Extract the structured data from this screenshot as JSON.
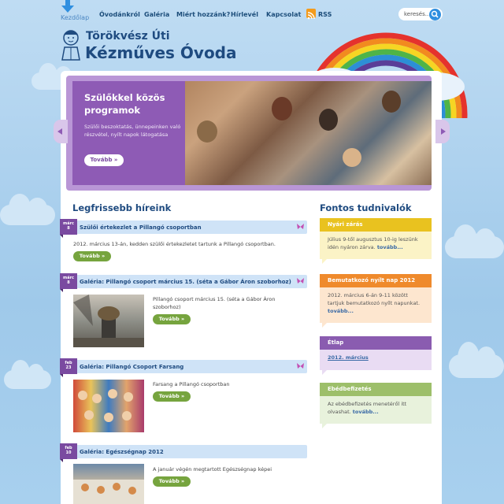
{
  "nav": {
    "items": [
      "Kezdőlap",
      "Óvodánkról",
      "Galéria",
      "Miért hozzánk?",
      "Hírlevél",
      "Kapcsolat",
      "RSS"
    ],
    "search_placeholder": "keresés..."
  },
  "logo": {
    "line1": "Törökvész Úti",
    "line2": "Kézműves Óvoda"
  },
  "slider": {
    "title": "Szülőkkel közös programok",
    "description": "Szülői beszoktatás, ünnepeinken való részvétel, nyílt napok látogatása",
    "button": "Tovább »"
  },
  "news": {
    "heading": "Legfrissebb híreink",
    "items": [
      {
        "month": "márc",
        "day": "8",
        "title": "Szülői értekezlet a Pillangó csoportban",
        "text": "2012. március 13-án, kedden szülői értekezletet tartunk a Pillangó csoportban.",
        "button": "Tovább »"
      },
      {
        "month": "márc",
        "day": "8",
        "title": "Galéria: Pillangó csoport március 15. (séta a Gábor Áron szoborhoz)",
        "text": "Pillangó csoport március 15. (séta a Gábor Áron szoborhoz)",
        "button": "Tovább »"
      },
      {
        "month": "feb",
        "day": "23",
        "title": "Galéria: Pillangó Csoport Farsang",
        "text": "Farsang a Pillangó csoportban",
        "button": "Tovább »"
      },
      {
        "month": "feb",
        "day": "10",
        "title": "Galéria: Egészségnap 2012",
        "text": "A január végén megtartott Egészségnap képei",
        "button": "Tovább »"
      }
    ]
  },
  "notices": {
    "heading": "Fontos tudnivalók",
    "boxes": [
      {
        "title": "Nyári zárás",
        "text": "Július 9-től augusztus 10-ig leszünk idén nyáron zárva.",
        "link": "tovább...",
        "head_color": "#e9c21f",
        "body_color": "#fbf3c6"
      },
      {
        "title": "Bemutatkozó nyílt nap 2012",
        "text": "2012. március 6-án 9-11 között tartjuk bemutatkozó nyílt napunkat.",
        "link": "tovább...",
        "head_color": "#ef8a2c",
        "body_color": "#fde6cf"
      },
      {
        "title": "Étlap",
        "text": "",
        "link": "2012. március",
        "head_color": "#8a5cb0",
        "body_color": "#e9dcf3"
      },
      {
        "title": "Ebédbefizetés",
        "text": "Az ebédbefizetés menetéről itt olvashat.",
        "link": "tovább...",
        "head_color": "#9dbf6a",
        "body_color": "#e8f2dc"
      }
    ]
  }
}
